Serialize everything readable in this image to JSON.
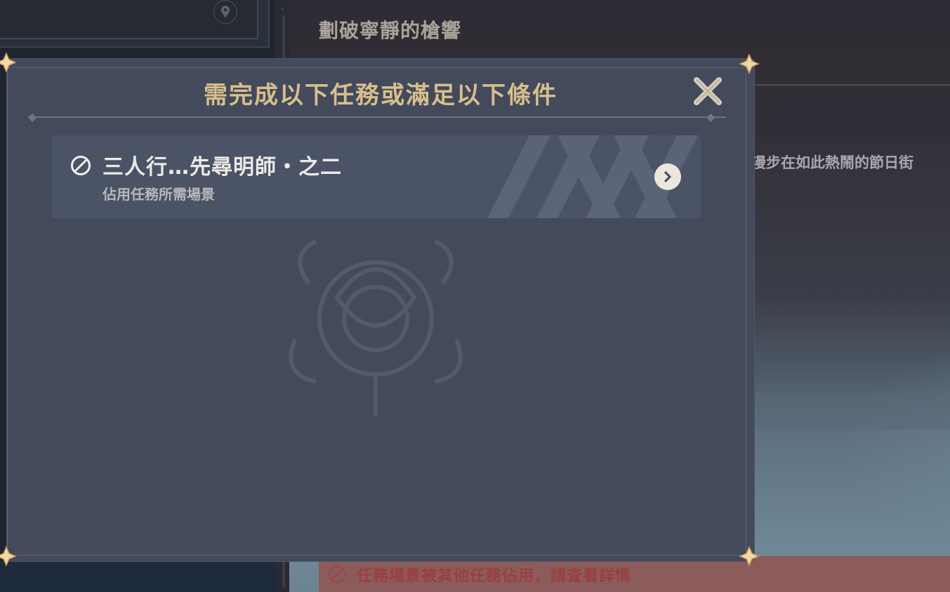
{
  "background": {
    "quest_title": "劃破寧靜的槍響",
    "description_snippet": "漫步在如此熱鬧的節日街",
    "warning_text": "任務場景被其他任務佔用，請查看詳情",
    "location_icon": "map-pin-icon"
  },
  "dialog": {
    "title": "需完成以下任務或滿足以下條件",
    "close_icon": "close-icon",
    "items": [
      {
        "name": "三人行…先尋明師・之二",
        "subtitle": "佔用任務所需場景",
        "status_icon": "prohibited-icon",
        "action_icon": "chevron-right-icon"
      }
    ]
  },
  "colors": {
    "title_gold": "#d8bf8c",
    "dialog_bg": "#424a5c",
    "row_bg": "#4b5366",
    "warning_bg": "#8b5c5b"
  }
}
